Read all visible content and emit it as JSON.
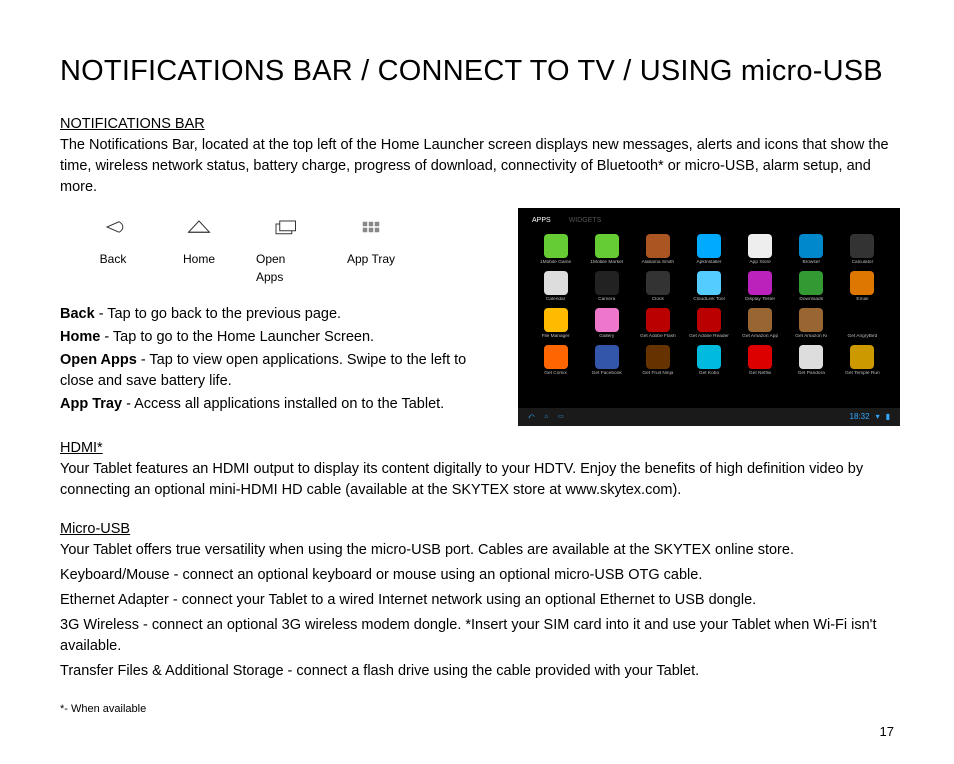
{
  "title": "NOTIFICATIONS BAR / CONNECT TO TV / USING micro-USB",
  "notif": {
    "label": "NOTIFICATIONS BAR",
    "body": "The Notifications Bar, located at the top left of the Home Launcher screen displays new messages, alerts and icons that show the time, wireless network status, battery charge, progress of download, connectivity of Bluetooth* or micro-USB, alarm setup, and more."
  },
  "nav": {
    "back": "Back",
    "home": "Home",
    "open_apps": "Open Apps",
    "app_tray": "App Tray"
  },
  "desc": {
    "back_term": "Back",
    "back_body": " - Tap to go back to the previous page.",
    "home_term": "Home",
    "home_body": " - Tap to go to the Home Launcher Screen.",
    "open_term": "Open Apps",
    "open_body": " - Tap to view open applications. Swipe to the left to close and save battery life.",
    "tray_term": "App Tray",
    "tray_body": " - Access all applications installed on to the Tablet."
  },
  "tablet": {
    "tab_apps": "APPS",
    "tab_widgets": "WIDGETS",
    "time": "18:32",
    "apps": [
      {
        "label": "1Mobile Game",
        "bg": "#6c3"
      },
      {
        "label": "1Mobile Market",
        "bg": "#6c3"
      },
      {
        "label": "Alabama Smith",
        "bg": "#a52"
      },
      {
        "label": "ApkInstaller",
        "bg": "#0af"
      },
      {
        "label": "App Store",
        "bg": "#eee"
      },
      {
        "label": "Browser",
        "bg": "#08c"
      },
      {
        "label": "Calculator",
        "bg": "#333"
      },
      {
        "label": "Calendar",
        "bg": "#ddd"
      },
      {
        "label": "Camera",
        "bg": "#222"
      },
      {
        "label": "Clock",
        "bg": "#333"
      },
      {
        "label": "CloudLink Tool",
        "bg": "#5cf"
      },
      {
        "label": "Display Tester",
        "bg": "#b2b"
      },
      {
        "label": "Downloads",
        "bg": "#393"
      },
      {
        "label": "Email",
        "bg": "#d70"
      },
      {
        "label": "File Manager",
        "bg": "#fb0"
      },
      {
        "label": "Gallery",
        "bg": "#e7c"
      },
      {
        "label": "Get Adobe Flash",
        "bg": "#b00"
      },
      {
        "label": "Get Adobe Reader",
        "bg": "#b00"
      },
      {
        "label": "Get Amazon App",
        "bg": "#963"
      },
      {
        "label": "Get Amazon Ki",
        "bg": "#963"
      },
      {
        "label": "Get AngryBird",
        "bg": "#000"
      },
      {
        "label": "Get Comix",
        "bg": "#f60"
      },
      {
        "label": "Get Facebook",
        "bg": "#35a"
      },
      {
        "label": "Get Fruit Ninja",
        "bg": "#630"
      },
      {
        "label": "Get Kobo",
        "bg": "#0bd"
      },
      {
        "label": "Get Netflix",
        "bg": "#d00"
      },
      {
        "label": "Get Pandora",
        "bg": "#ddd"
      },
      {
        "label": "Get Temple Run",
        "bg": "#c90"
      }
    ]
  },
  "hdmi": {
    "label": "HDMI*",
    "body": "Your Tablet features an HDMI output to display its content digitally to your HDTV. Enjoy the benefits of high definition video by connecting an optional mini-HDMI HD cable (available at the SKYTEX store at www.skytex.com)."
  },
  "usb": {
    "label": "Micro-USB",
    "l1": "Your Tablet offers true versatility when using the micro-USB port. Cables are available at the SKYTEX online store.",
    "l2": "Keyboard/Mouse - connect an optional keyboard or mouse using an optional micro-USB OTG cable.",
    "l3": "Ethernet Adapter - connect your Tablet to a wired Internet network using an optional Ethernet to USB dongle.",
    "l4": "3G Wireless - connect an optional 3G wireless modem dongle. *Insert your SIM card into it and use your Tablet when Wi-Fi isn't available.",
    "l5": "Transfer Files & Additional Storage - connect a flash drive using the cable provided with your Tablet."
  },
  "footnote": "*- When available",
  "page": "17"
}
